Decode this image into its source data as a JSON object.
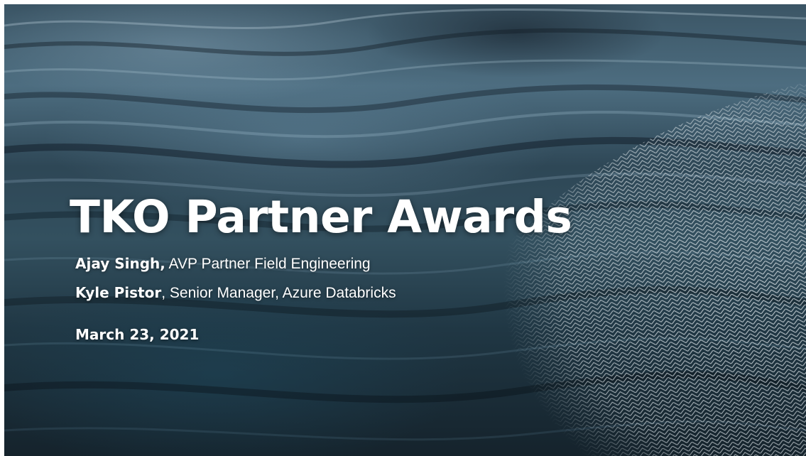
{
  "slide": {
    "title": "TKO Partner Awards",
    "speakers": [
      {
        "name": "Ajay Singh,",
        "role": " AVP Partner Field Engineering"
      },
      {
        "name": "Kyle Pistor",
        "role": ", Senior Manager, Azure Databricks"
      }
    ],
    "date": "March 23, 2021",
    "background": "water-waves-photo",
    "overlay": "wire-mesh-pattern",
    "colors": {
      "text": "#ffffff",
      "water_light": "#4d6d80",
      "water_dark": "#15232c",
      "mesh": "#dfe6ea"
    }
  }
}
